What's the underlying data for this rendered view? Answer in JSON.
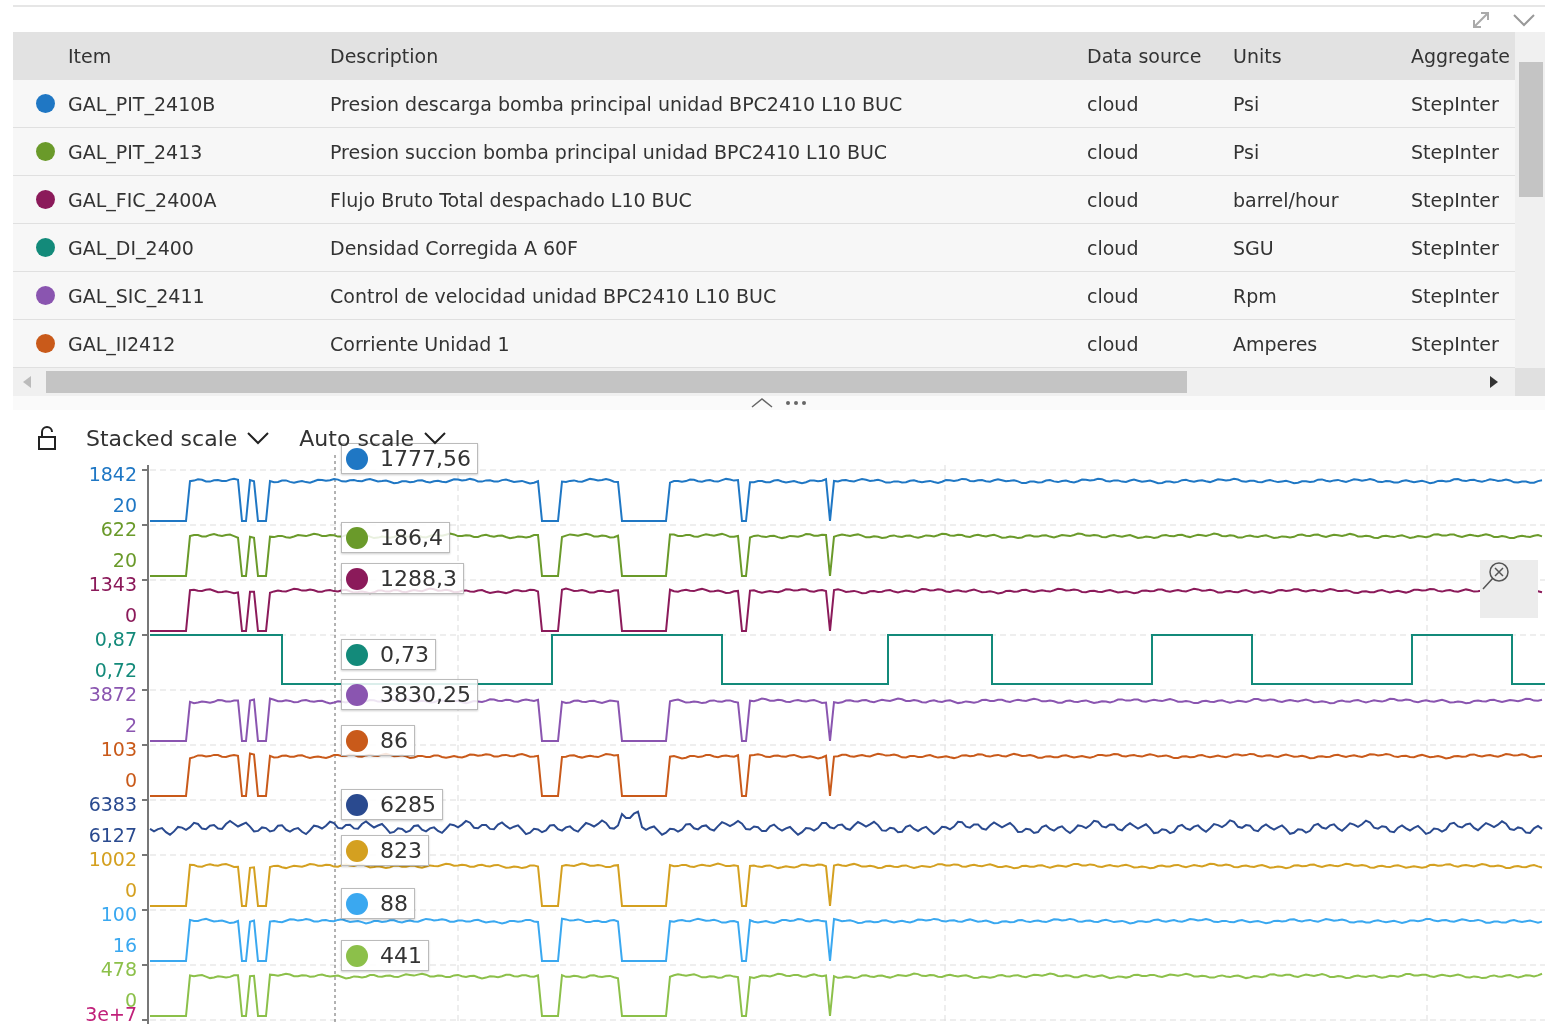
{
  "table": {
    "columns": [
      "Item",
      "Description",
      "Data source",
      "Units",
      "Aggregate"
    ],
    "rows": [
      {
        "color": "#1f77c4",
        "item": "GAL_PIT_2410B",
        "description": "Presion descarga bomba principal unidad BPC2410 L10 BUC",
        "data_source": "cloud",
        "units": "Psi",
        "aggregate": "StepInter"
      },
      {
        "color": "#6a9a2a",
        "item": "GAL_PIT_2413",
        "description": "Presion succion bomba principal unidad BPC2410 L10 BUC",
        "data_source": "cloud",
        "units": "Psi",
        "aggregate": "StepInter"
      },
      {
        "color": "#8b1a5a",
        "item": "GAL_FIC_2400A",
        "description": "Flujo Bruto Total despachado L10 BUC",
        "data_source": "cloud",
        "units": "barrel/hour",
        "aggregate": "StepInter"
      },
      {
        "color": "#138a7a",
        "item": "GAL_DI_2400",
        "description": "Densidad Corregida A 60F",
        "data_source": "cloud",
        "units": "SGU",
        "aggregate": "StepInter"
      },
      {
        "color": "#8a55b0",
        "item": "GAL_SIC_2411",
        "description": "Control de velocidad unidad BPC2410 L10 BUC",
        "data_source": "cloud",
        "units": "Rpm",
        "aggregate": "StepInter"
      },
      {
        "color": "#c95a1a",
        "item": "GAL_II2412",
        "description": "Corriente Unidad 1",
        "data_source": "cloud",
        "units": "Amperes",
        "aggregate": "StepInter"
      }
    ]
  },
  "chart_toolbar": {
    "scale_mode": "Stacked scale",
    "range_mode": "Auto scale"
  },
  "lanes": [
    {
      "color": "#1f77c4",
      "max_label": "1842",
      "min_label": "20",
      "cursor_value": "1777,56"
    },
    {
      "color": "#6a9a2a",
      "max_label": "622",
      "min_label": "20",
      "cursor_value": "186,4"
    },
    {
      "color": "#8b1a5a",
      "max_label": "1343",
      "min_label": "0",
      "cursor_value": "1288,3"
    },
    {
      "color": "#138a7a",
      "max_label": "0,87",
      "min_label": "0,72",
      "cursor_value": "0,73"
    },
    {
      "color": "#8a55b0",
      "max_label": "3872",
      "min_label": "2",
      "cursor_value": "3830,25"
    },
    {
      "color": "#c95a1a",
      "max_label": "103",
      "min_label": "0",
      "cursor_value": "86"
    },
    {
      "color": "#2a4a8f",
      "max_label": "6383",
      "min_label": "6127",
      "cursor_value": "6285"
    },
    {
      "color": "#d4a020",
      "max_label": "1002",
      "min_label": "0",
      "cursor_value": "823"
    },
    {
      "color": "#3aa8f0",
      "max_label": "100",
      "min_label": "16",
      "cursor_value": "88"
    },
    {
      "color": "#8cc04a",
      "max_label": "478",
      "min_label": "0",
      "cursor_value": "441"
    },
    {
      "color": "#c0207a",
      "max_label": "3e+7"
    }
  ]
}
